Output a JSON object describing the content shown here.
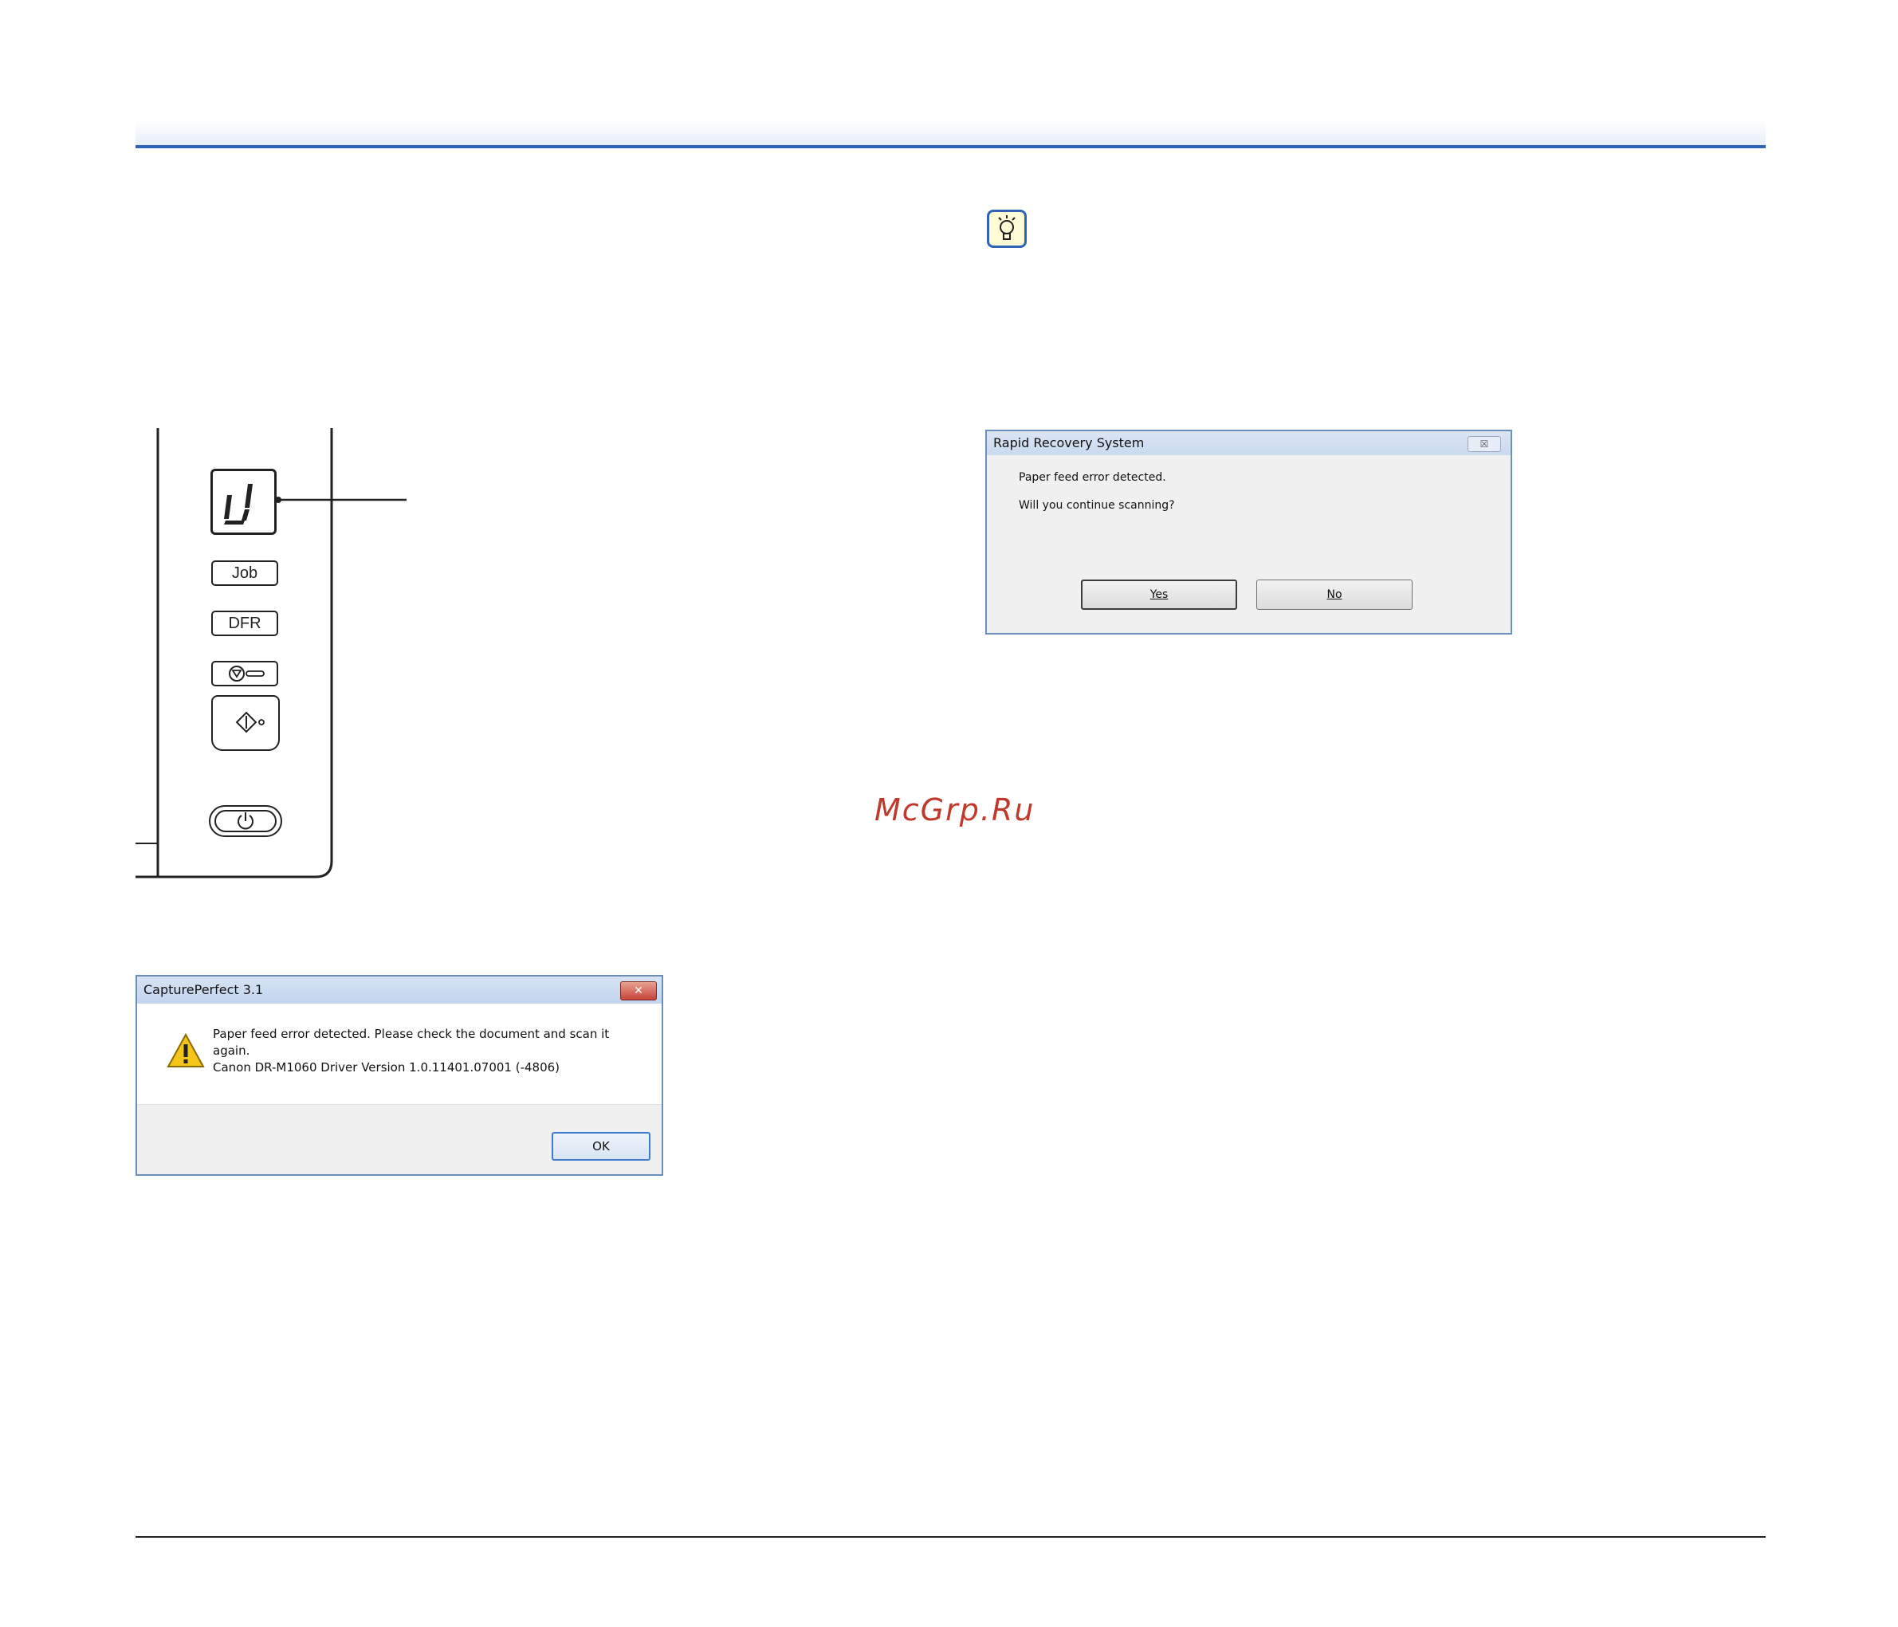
{
  "panel": {
    "job_label": "Job",
    "dfr_label": "DFR"
  },
  "rapid_recovery_dialog": {
    "title": "Rapid Recovery System",
    "close_glyph": "☒",
    "message_line1": "Paper feed error detected.",
    "message_line2": "Will you continue scanning?",
    "yes_label": "Yes",
    "no_label": "No"
  },
  "captureperfect_dialog": {
    "title": "CapturePerfect 3.1",
    "close_glyph": "✕",
    "message_line1": "Paper feed error detected.  Please check the document and scan it",
    "message_line2": "again.",
    "message_line3": "Canon DR-M1060 Driver Version 1.0.11401.07001 (-4806)",
    "ok_label": "OK"
  },
  "watermark": "McGrp.Ru",
  "colors": {
    "accent_blue": "#2f63b4",
    "watermark_red": "#c0392b"
  }
}
